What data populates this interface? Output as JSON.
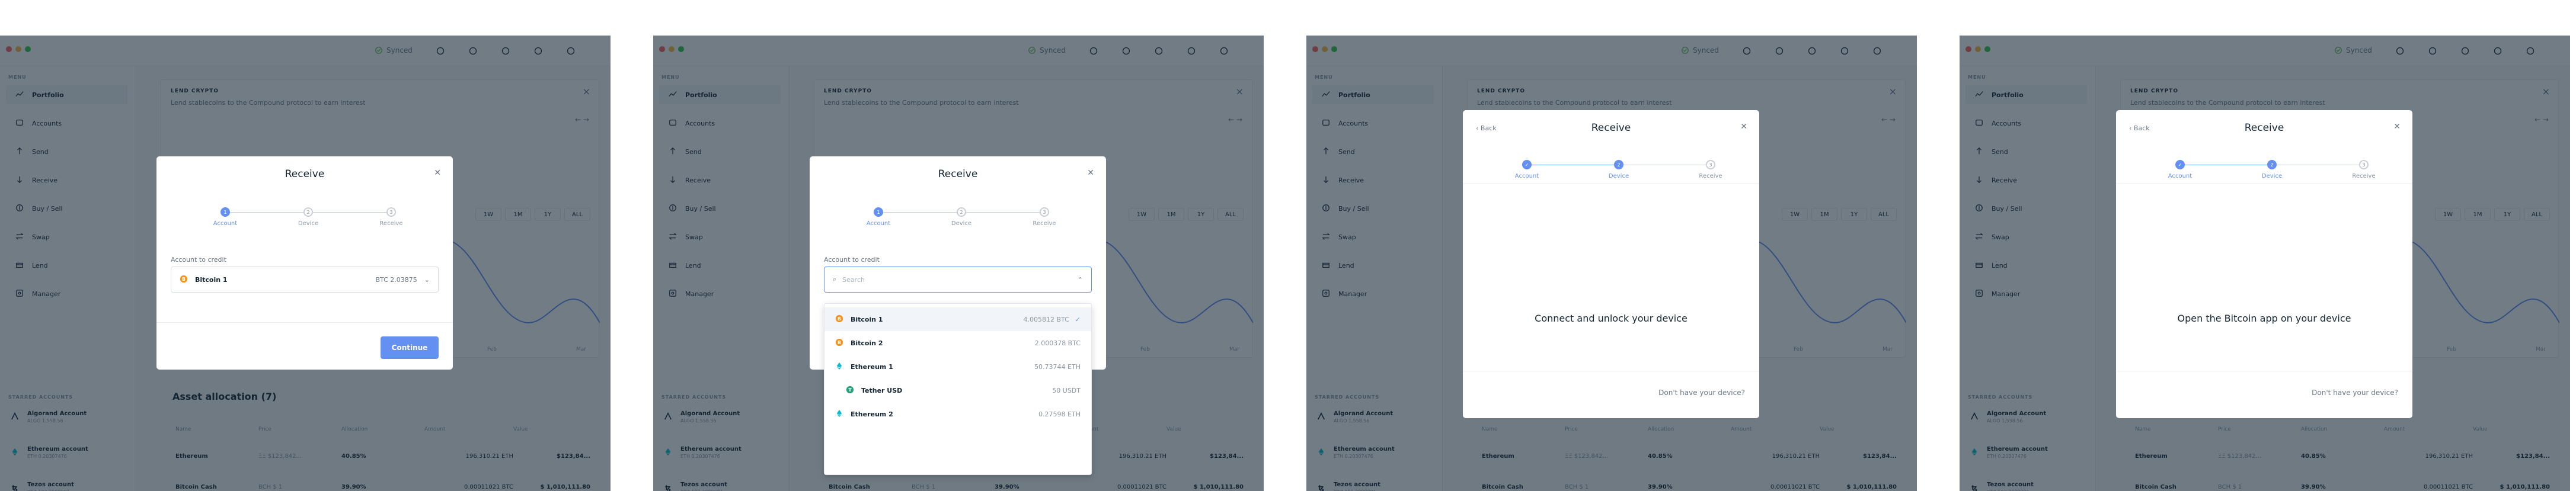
{
  "app": {
    "sync_label": "Synced",
    "menu_label": "MENU",
    "nav": [
      "Portfolio",
      "Accounts",
      "Send",
      "Receive",
      "Buy / Sell",
      "Swap",
      "Lend",
      "Manager"
    ],
    "starred_label": "STARRED ACCOUNTS",
    "starred": [
      {
        "name": "Algorand Account",
        "balance": "ALGO 1,558.56",
        "icon": "algorand-icon"
      },
      {
        "name": "Ethereum account",
        "balance": "ETH 0.20307476",
        "icon": "ethereum-icon"
      },
      {
        "name": "Tezos account",
        "balance": "XTZ 103.2099081",
        "icon": "tezos-icon"
      }
    ],
    "colors": {
      "accent": "#6490f1",
      "overlay": "#142533",
      "bitcoin": "#f7931a",
      "ethereum": "#0ebdcd",
      "tether": "#26a17b"
    }
  },
  "background": {
    "banner_title": "LEND CRYPTO",
    "banner_subtitle": "Lend stablecoins to the Compound protocol to earn interest",
    "ranges": [
      "1W",
      "1M",
      "1Y",
      "ALL"
    ],
    "x_ticks": [
      "Feb",
      "Mar"
    ],
    "allocation_title": "Asset allocation (7)",
    "table_headers": [
      "Name",
      "Price",
      "Allocation",
      "Amount",
      "Value"
    ],
    "rows": [
      {
        "name": "Ethereum",
        "price": "ΞΞ $123,842...",
        "alloc": "40.85%",
        "amount": "196,310.21 ETH",
        "value": "$123,84..."
      },
      {
        "name": "Bitcoin Cash",
        "price": "BCH $ 1",
        "alloc": "39.90%",
        "amount": "0.00011021 BTC",
        "value": "$ 1,010,111.80"
      }
    ]
  },
  "frames": [
    {
      "title": "Receive",
      "steps": [
        {
          "n": "1",
          "label": "Account"
        },
        {
          "n": "2",
          "label": "Device"
        },
        {
          "n": "3",
          "label": "Receive"
        }
      ],
      "account_label": "Account to credit",
      "selected_account": "Bitcoin 1",
      "selected_balance": "BTC 2.03875",
      "continue_label": "Continue"
    },
    {
      "title": "Receive",
      "steps": [
        {
          "n": "1",
          "label": "Account"
        },
        {
          "n": "2",
          "label": "Device"
        },
        {
          "n": "3",
          "label": "Receive"
        }
      ],
      "account_label": "Account to credit",
      "search_placeholder": "Search",
      "options": [
        {
          "name": "Bitcoin 1",
          "balance": "4.005812 BTC",
          "icon": "bitcoin-icon"
        },
        {
          "name": "Bitcoin 2",
          "balance": "2.000378 BTC",
          "icon": "bitcoin-icon"
        },
        {
          "name": "Ethereum 1",
          "balance": "50.73744 ETH",
          "icon": "ethereum-icon"
        },
        {
          "name": "Tether USD",
          "balance": "50 USDT",
          "icon": "tether-icon"
        },
        {
          "name": "Ethereum 2",
          "balance": "0.27598 ETH",
          "icon": "ethereum-icon"
        }
      ]
    },
    {
      "title": "Receive",
      "back_label": "Back",
      "steps": [
        {
          "n": "1",
          "label": "Account"
        },
        {
          "n": "2",
          "label": "Device"
        },
        {
          "n": "3",
          "label": "Receive"
        }
      ],
      "message": "Connect and unlock your device",
      "footer_link": "Don't have your device?"
    },
    {
      "title": "Receive",
      "back_label": "Back",
      "steps": [
        {
          "n": "1",
          "label": "Account"
        },
        {
          "n": "2",
          "label": "Device"
        },
        {
          "n": "3",
          "label": "Receive"
        }
      ],
      "message": "Open the Bitcoin app on your device",
      "footer_link": "Don't have your device?"
    }
  ]
}
